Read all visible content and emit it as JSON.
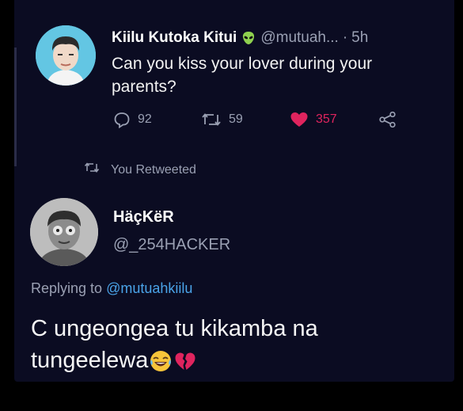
{
  "tweet": {
    "author_name": "Kiilu Kutoka Kitui",
    "author_badge_icon": "alien-emoji-icon",
    "handle": "@mutuah...",
    "separator": "·",
    "time": "5h",
    "text": "Can you kiss your lover during your parents?",
    "actions": {
      "reply_count": "92",
      "retweet_count": "59",
      "like_count": "357",
      "like_color": "#e0245e"
    }
  },
  "retweet_note": {
    "icon": "retweet-icon",
    "text": "You Retweeted"
  },
  "reply": {
    "author_name": "HäçKëR",
    "handle": "@_254HACKER",
    "replying_prefix": "Replying to",
    "replying_to": "@mutuahkiilu",
    "text_line1": "C ungeongea tu kikamba na",
    "text_line2": "tungeelewa",
    "emojis": [
      "laughing-emoji-icon",
      "broken-heart-emoji-icon"
    ]
  },
  "colors": {
    "background": "#0b0c22",
    "secondary_text": "#9aa0b3",
    "link": "#4aa3e8",
    "avatar1_bg": "#63c6e3"
  }
}
